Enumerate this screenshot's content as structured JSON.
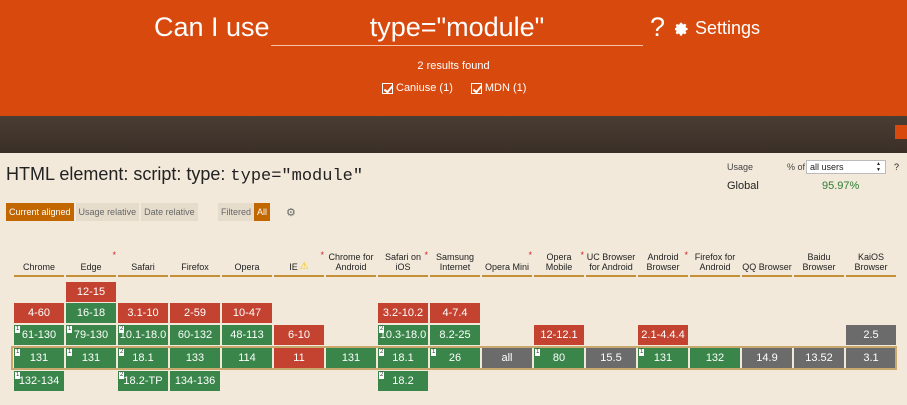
{
  "header": {
    "prefix": "Can I use",
    "query": "type=\"module\"",
    "help": "?",
    "settings_label": "Settings",
    "results_text": "2 results found",
    "filters": [
      {
        "label": "Caniuse (1)"
      },
      {
        "label": "MDN (1)"
      }
    ]
  },
  "feature": {
    "title_prefix": "HTML element: script: type:",
    "title_code": "type=\"module\""
  },
  "usage": {
    "label": "Usage",
    "pct_of": "% of",
    "users_option": "all users",
    "help": "?",
    "global_label": "Global",
    "global_pct": "95.97%"
  },
  "tabs": {
    "current": "Current aligned",
    "relative": "Usage relative",
    "date": "Date relative",
    "filtered": "Filtered",
    "all": "All"
  },
  "browsers": [
    {
      "name": "Chrome",
      "star": false
    },
    {
      "name": "Edge",
      "star": true
    },
    {
      "name": "Safari",
      "star": false
    },
    {
      "name": "Firefox",
      "star": false
    },
    {
      "name": "Opera",
      "star": false
    },
    {
      "name": "IE",
      "star": true
    },
    {
      "name": "Chrome for Android",
      "star": false
    },
    {
      "name": "Safari on iOS",
      "star": true
    },
    {
      "name": "Samsung Internet",
      "star": false
    },
    {
      "name": "Opera Mini",
      "star": true
    },
    {
      "name": "Opera Mobile",
      "star": true
    },
    {
      "name": "UC Browser for Android",
      "star": false
    },
    {
      "name": "Android Browser",
      "star": true
    },
    {
      "name": "Firefox for Android",
      "star": false
    },
    {
      "name": "QQ Browser",
      "star": false
    },
    {
      "name": "Baidu Browser",
      "star": false
    },
    {
      "name": "KaiOS Browser",
      "star": false
    }
  ],
  "cells": {
    "r0": [
      "",
      "12-15",
      "",
      "",
      "",
      "",
      "",
      "",
      "",
      "",
      "",
      "",
      "",
      "",
      "",
      "",
      ""
    ],
    "r1": [
      "4-60",
      "16-18",
      "3.1-10",
      "2-59",
      "10-47",
      "",
      "",
      "3.2-10.2",
      "4-7.4",
      "",
      "",
      "",
      "",
      "",
      "",
      "",
      ""
    ],
    "r2": [
      "61-130",
      "79-130",
      "10.1-18.0",
      "60-132",
      "48-113",
      "6-10",
      "",
      "10.3-18.0",
      "8.2-25",
      "",
      "12-12.1",
      "",
      "2.1-4.4.4",
      "",
      "",
      "",
      "2.5"
    ],
    "r3": [
      "131",
      "131",
      "18.1",
      "133",
      "114",
      "11",
      "131",
      "18.1",
      "26",
      "all",
      "80",
      "15.5",
      "131",
      "132",
      "14.9",
      "13.52",
      "3.1"
    ],
    "r4": [
      "132-134",
      "",
      "18.2-TP",
      "134-136",
      "",
      "",
      "",
      "18.2",
      "",
      "",
      "",
      "",
      "",
      "",
      "",
      "",
      ""
    ]
  },
  "notes": {
    "n1": "1",
    "n2": "2"
  },
  "colors": {
    "header_bg": "#d8490d",
    "supported": "#39854a",
    "unsupported": "#c44230",
    "unknown": "#6b6b6b",
    "accent": "#c26600"
  }
}
